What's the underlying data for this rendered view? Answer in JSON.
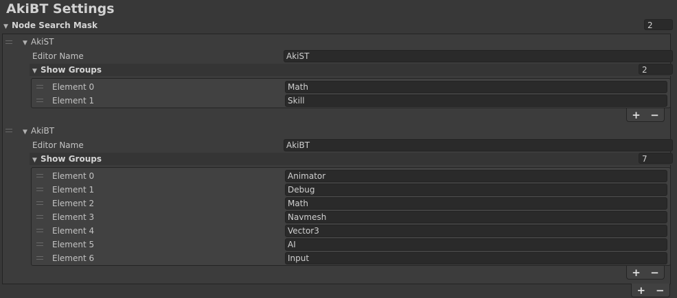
{
  "window": {
    "title": "AkiBT Settings"
  },
  "node_search_mask": {
    "label": "Node Search Mask",
    "count": "2"
  },
  "items": [
    {
      "name": "AkiST",
      "editor_name_label": "Editor Name",
      "editor_name_value": "AkiST",
      "show_groups_label": "Show Groups",
      "show_groups_count": "2",
      "elements": [
        {
          "label": "Element 0",
          "value": "Math"
        },
        {
          "label": "Element 1",
          "value": "Skill"
        }
      ]
    },
    {
      "name": "AkiBT",
      "editor_name_label": "Editor Name",
      "editor_name_value": "AkiBT",
      "show_groups_label": "Show Groups",
      "show_groups_count": "7",
      "elements": [
        {
          "label": "Element 0",
          "value": "Animator"
        },
        {
          "label": "Element 1",
          "value": "Debug"
        },
        {
          "label": "Element 2",
          "value": "Math"
        },
        {
          "label": "Element 3",
          "value": "Navmesh"
        },
        {
          "label": "Element 4",
          "value": "Vector3"
        },
        {
          "label": "Element 5",
          "value": "AI"
        },
        {
          "label": "Element 6",
          "value": "Input"
        }
      ]
    }
  ],
  "buttons": {
    "add": "+",
    "remove": "−"
  }
}
